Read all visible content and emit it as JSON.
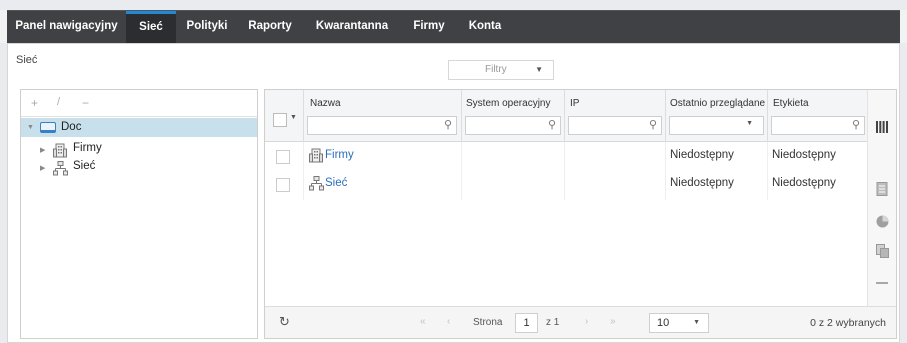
{
  "nav": {
    "tabs": [
      {
        "label": "Panel nawigacyjny",
        "active": false
      },
      {
        "label": "Sieć",
        "active": true
      },
      {
        "label": "Polityki",
        "active": false
      },
      {
        "label": "Raporty",
        "active": false
      },
      {
        "label": "Kwarantanna",
        "active": false
      },
      {
        "label": "Firmy",
        "active": false
      },
      {
        "label": "Konta",
        "active": false
      }
    ]
  },
  "breadcrumb": "Sieć",
  "filters": {
    "label": "Filtry"
  },
  "tree": {
    "toolbar": {
      "add": "+",
      "edit": "/",
      "remove": "−"
    },
    "root": {
      "label": "Doc",
      "icon": "folder-icon"
    },
    "children": [
      {
        "label": "Firmy",
        "icon": "building-icon"
      },
      {
        "label": "Sieć",
        "icon": "network-icon"
      }
    ]
  },
  "grid": {
    "columns": {
      "name": "Nazwa",
      "os": "System operacyjny",
      "ip": "IP",
      "last_seen": "Ostatnio przeglądane",
      "label": "Etykieta"
    },
    "rows": [
      {
        "name": "Firmy",
        "icon": "building-icon",
        "os": "",
        "ip": "",
        "last_seen": "Niedostępny",
        "label": "Niedostępny"
      },
      {
        "name": "Sieć",
        "icon": "network-icon",
        "os": "",
        "ip": "",
        "last_seen": "Niedostępny",
        "label": "Niedostępny"
      }
    ],
    "pagination": {
      "first": "«",
      "prev": "‹",
      "page_label": "Strona",
      "page": "1",
      "of_label": "z 1",
      "next": "›",
      "last": "»",
      "page_size": "10",
      "selected_count": "0 z 2 wybranych"
    }
  },
  "colors": {
    "nav_bg": "#3f4144",
    "active_tab_accent": "#1e88d9",
    "link": "#2a6ebb",
    "tree_selection": "#c7e0ec"
  }
}
